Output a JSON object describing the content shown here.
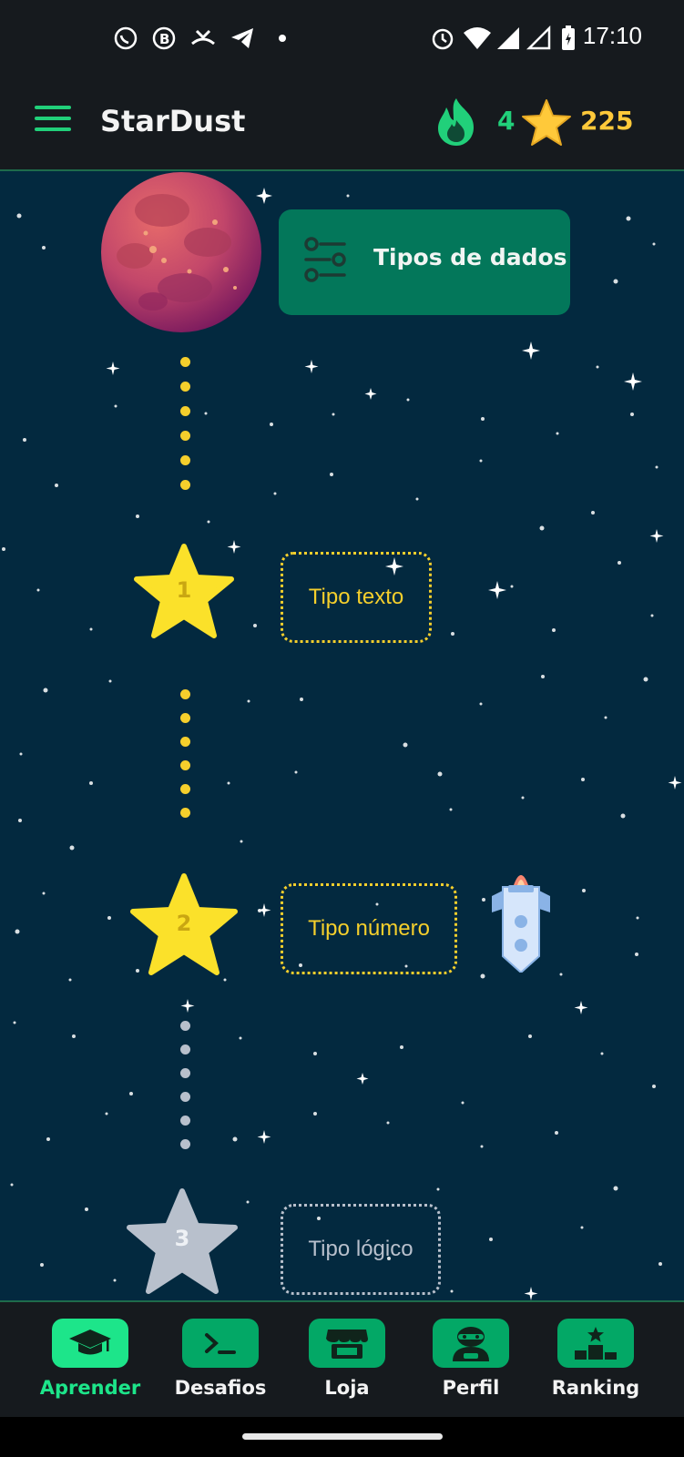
{
  "status_bar": {
    "time": "17:10"
  },
  "app_bar": {
    "title": "StarDust",
    "streak": "4",
    "points": "225"
  },
  "module": {
    "title": "Tipos de dados"
  },
  "lessons": [
    {
      "number": "1",
      "title": "Tipo texto",
      "state": "completed"
    },
    {
      "number": "2",
      "title": "Tipo número",
      "state": "completed"
    },
    {
      "number": "3",
      "title": "Tipo lógico",
      "state": "locked"
    }
  ],
  "bottom_nav": [
    {
      "label": "Aprender",
      "icon": "graduation-cap-icon",
      "active": true
    },
    {
      "label": "Desafios",
      "icon": "terminal-icon",
      "active": false
    },
    {
      "label": "Loja",
      "icon": "store-icon",
      "active": false
    },
    {
      "label": "Perfil",
      "icon": "profile-icon",
      "active": false
    },
    {
      "label": "Ranking",
      "icon": "podium-icon",
      "active": false
    }
  ],
  "colors": {
    "accent": "#21d07a",
    "gold": "#f5cf2c",
    "space": "#03293f",
    "locked": "#b8c0cc"
  }
}
